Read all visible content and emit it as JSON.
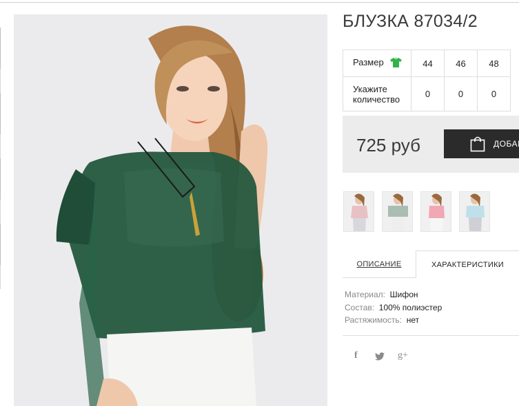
{
  "product": {
    "title": "БЛУЗКА 87034/2",
    "price": "725 руб",
    "add_button_label": "ДОБАВ"
  },
  "size_table": {
    "size_label": "Размер",
    "qty_label": "Укажите количество",
    "sizes": [
      "44",
      "46",
      "48"
    ],
    "quantities": [
      "0",
      "0",
      "0"
    ]
  },
  "tabs": {
    "description": "ОПИСАНИЕ",
    "characteristics": "ХАРАКТЕРИСТИКИ"
  },
  "specs": [
    {
      "key": "Материал:",
      "value": "Шифон"
    },
    {
      "key": "Состав:",
      "value": "100% полиэстер"
    },
    {
      "key": "Растяжимость:",
      "value": "нет"
    }
  ],
  "social": {
    "facebook": "f",
    "twitter": "twitter-icon",
    "googleplus": "g+"
  },
  "thumbnails": [
    {
      "color": "#e9c1c4",
      "name": "pink-blouse-thumb"
    },
    {
      "color": "#a9bdb2",
      "name": "grey-green-blouse-thumb"
    },
    {
      "color": "#f2a7b5",
      "name": "coral-blouse-thumb"
    },
    {
      "color": "#bfe0ea",
      "name": "light-blue-blouse-thumb"
    }
  ],
  "colors": {
    "accent_green": "#2fb34a",
    "button_dark": "#2b2b2b",
    "blouse_green": "#23583f"
  }
}
